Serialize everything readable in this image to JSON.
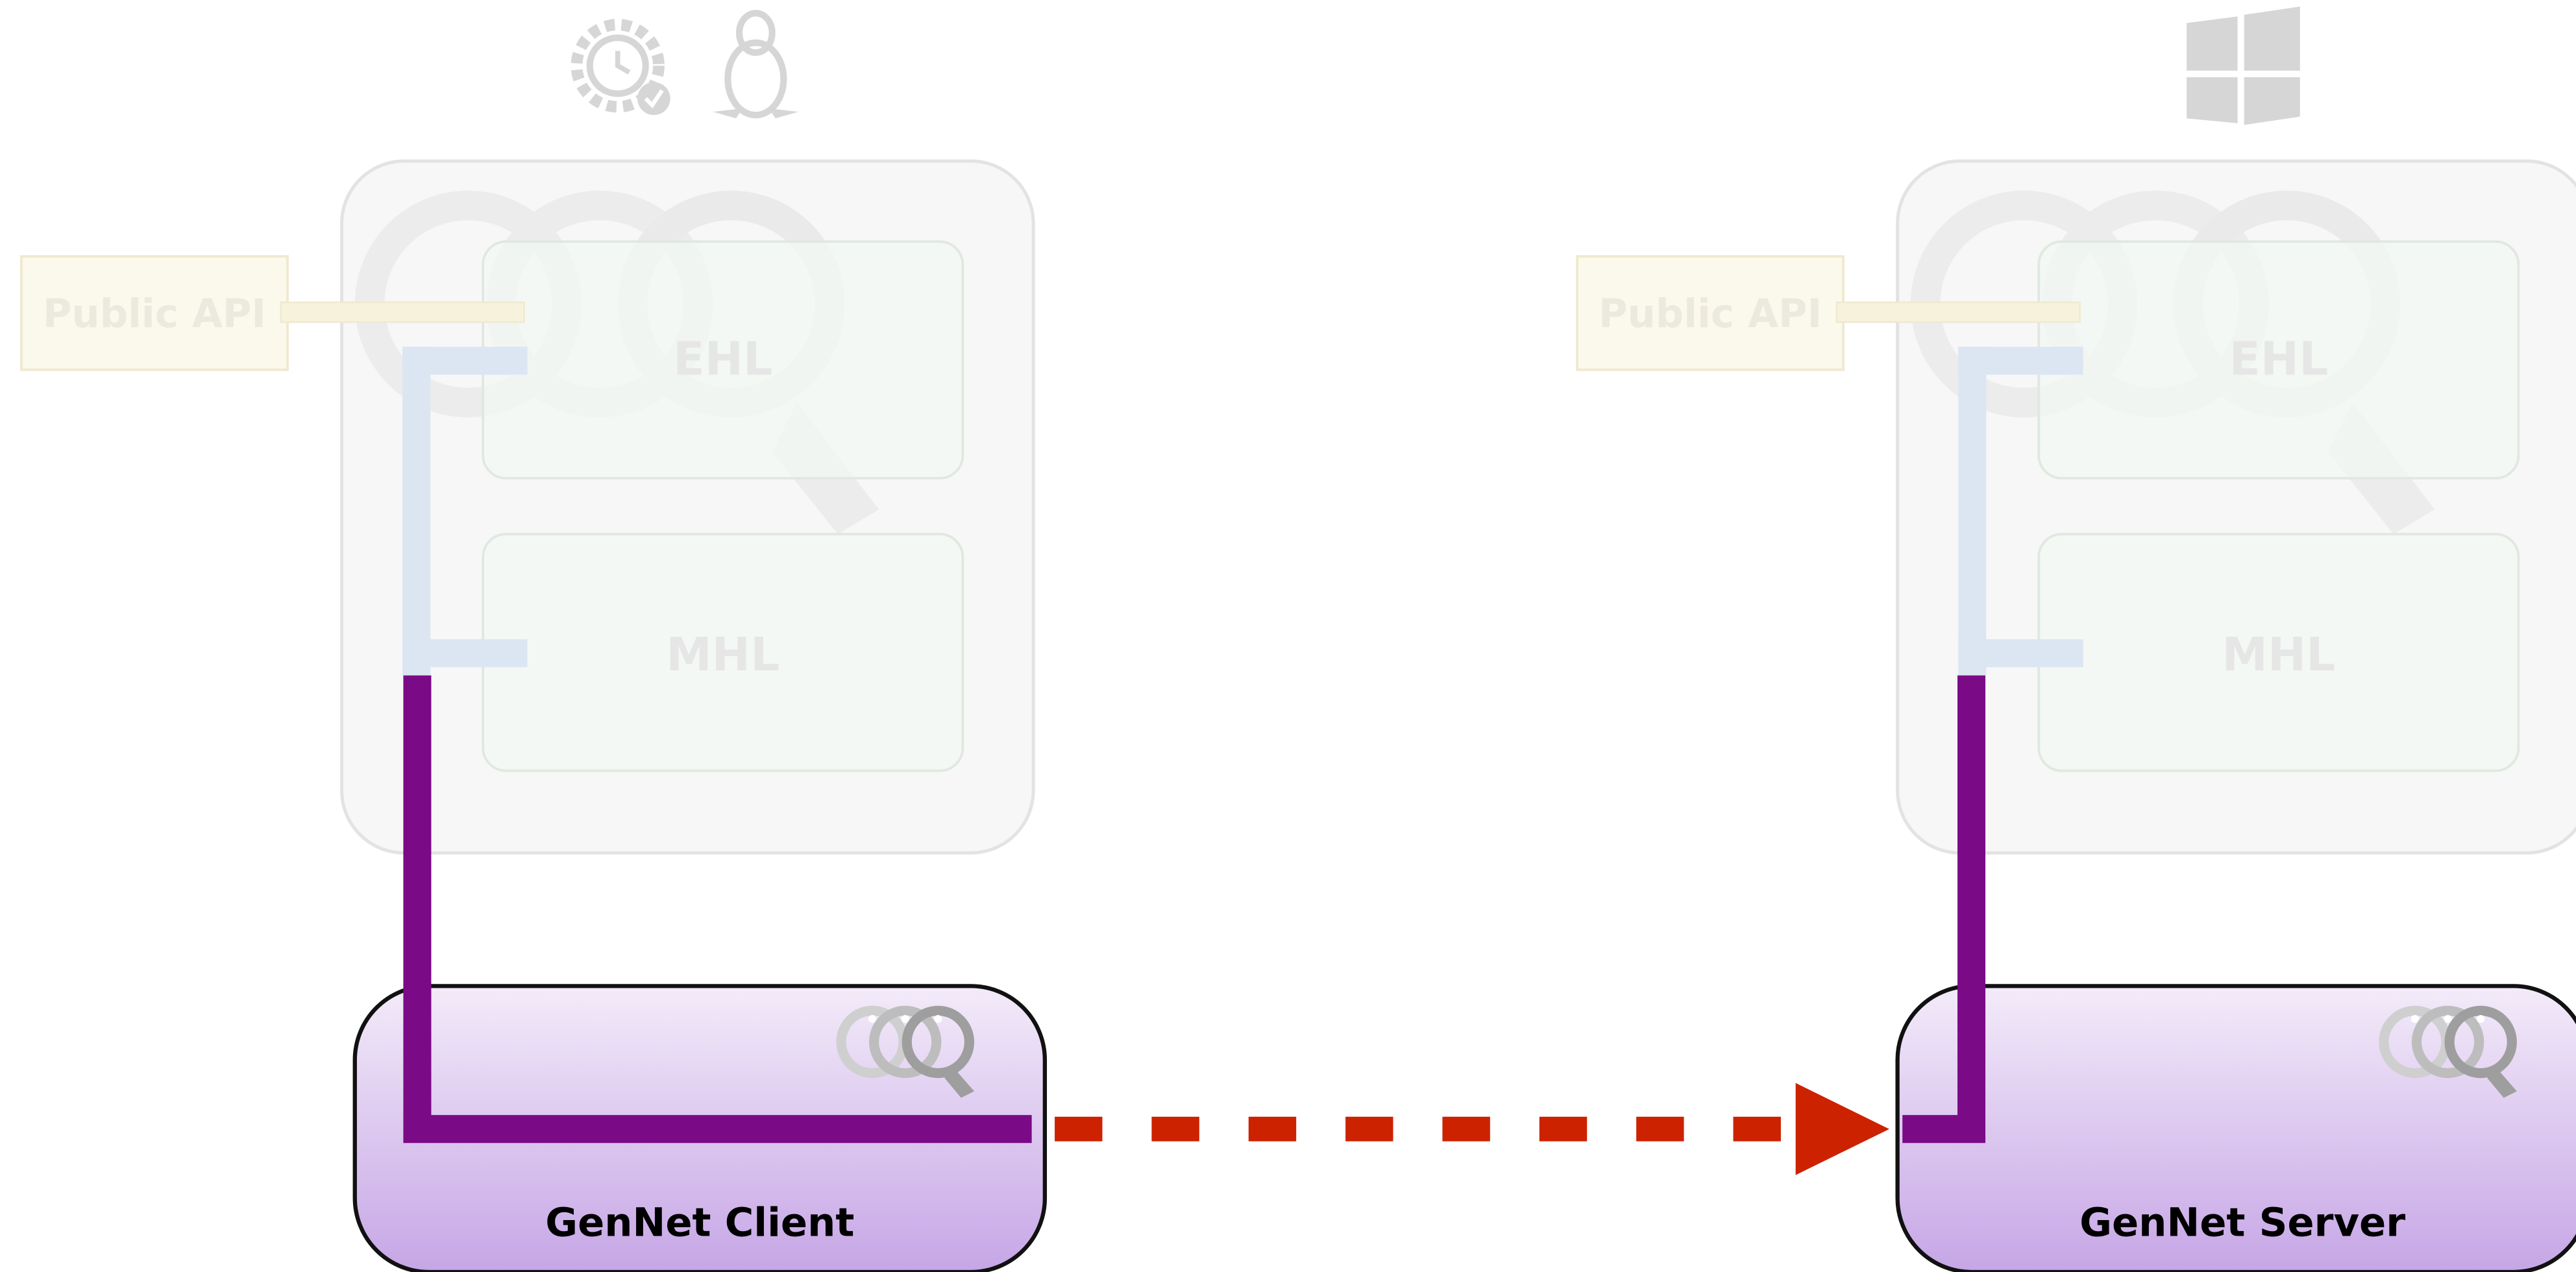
{
  "client": {
    "os_icons": [
      "maintenance-gear-icon",
      "linux-tux-icon"
    ],
    "api_label": "Public API",
    "ehl_label": "EHL",
    "mhl_label": "MHL",
    "node_label": "GenNet Client",
    "logo_icon": "gennet-rings-icon"
  },
  "server": {
    "os_icons": [
      "windows-icon"
    ],
    "api_label": "Public API",
    "ehl_label": "EHL",
    "mhl_label": "MHL",
    "node_label": "GenNet Server",
    "logo_icon": "gennet-rings-icon"
  },
  "link": {
    "style": "dashed-arrow",
    "direction": "client-to-server"
  },
  "colors": {
    "path_purple": "#7b0a86",
    "arrow_red": "#cc2200",
    "node_gradient_top": "#f3ebf9",
    "node_gradient_bottom": "#c6a6e6",
    "connector_blue_faded": "#dbe6f2",
    "api_box_faded": "#fbf8ec",
    "layer_box_faded": "#f2f7f2",
    "container_faded": "#f7f7f7"
  }
}
